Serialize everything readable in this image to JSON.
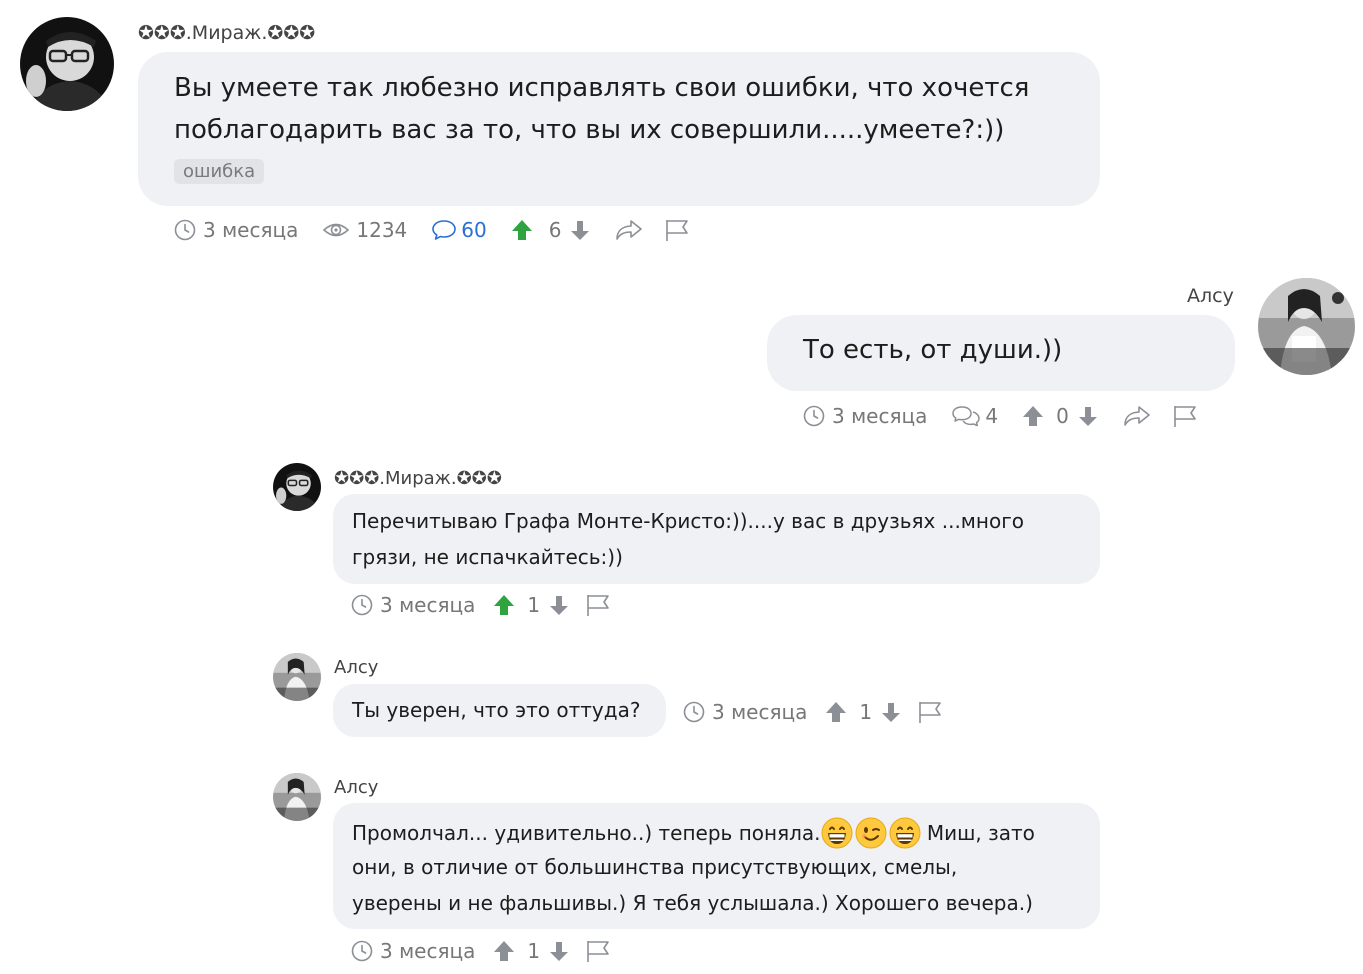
{
  "colors": {
    "bubble": "#f0f1f4",
    "tag_bg": "#e2e3e6",
    "meta_text": "#777777",
    "link_blue": "#2b6fd4",
    "upvote_active": "#2ea33f",
    "icon_gray": "#8c8f95"
  },
  "post": {
    "author": "✪✪✪.Мираж.✪✪✪",
    "text_line1": "Вы умеете так любезно исправлять свои ошибки, что хочется",
    "text_line2": "поблагодарить вас за то, что вы их совершили.....умеете?:))",
    "tag": "ошибка",
    "time": "3 месяца",
    "views": "1234",
    "comments": "60",
    "votes": "6"
  },
  "reply1": {
    "author": "Алсу",
    "text": "То есть, от души.))",
    "time": "3 месяца",
    "comments": "4",
    "votes": "0"
  },
  "reply2": {
    "author": "✪✪✪.Мираж.✪✪✪",
    "text_line1": "Перечитываю Графа Монте-Кристо:))....у вас в друзьях ...много",
    "text_line2": "грязи, не испачкайтесь:))",
    "time": "3 месяца",
    "votes": "1"
  },
  "reply3": {
    "author": "Алсу",
    "text": "Ты уверен, что это оттуда?",
    "time": "3 месяца",
    "votes": "1"
  },
  "reply4": {
    "author": "Алсу",
    "text_line1_a": "Промолчал... удивительно..) теперь поняла.",
    "text_line1_b": " Миш, зато",
    "text_line2": "они, в отличие от большинства присутствующих, смелы,",
    "text_line3": "уверены и не фальшивы.) Я тебя услышала.) Хорошего вечера.)",
    "time": "3 месяца",
    "votes": "1",
    "emojis": [
      "grinning-emoji",
      "winking-emoji",
      "grinning-emoji"
    ]
  }
}
